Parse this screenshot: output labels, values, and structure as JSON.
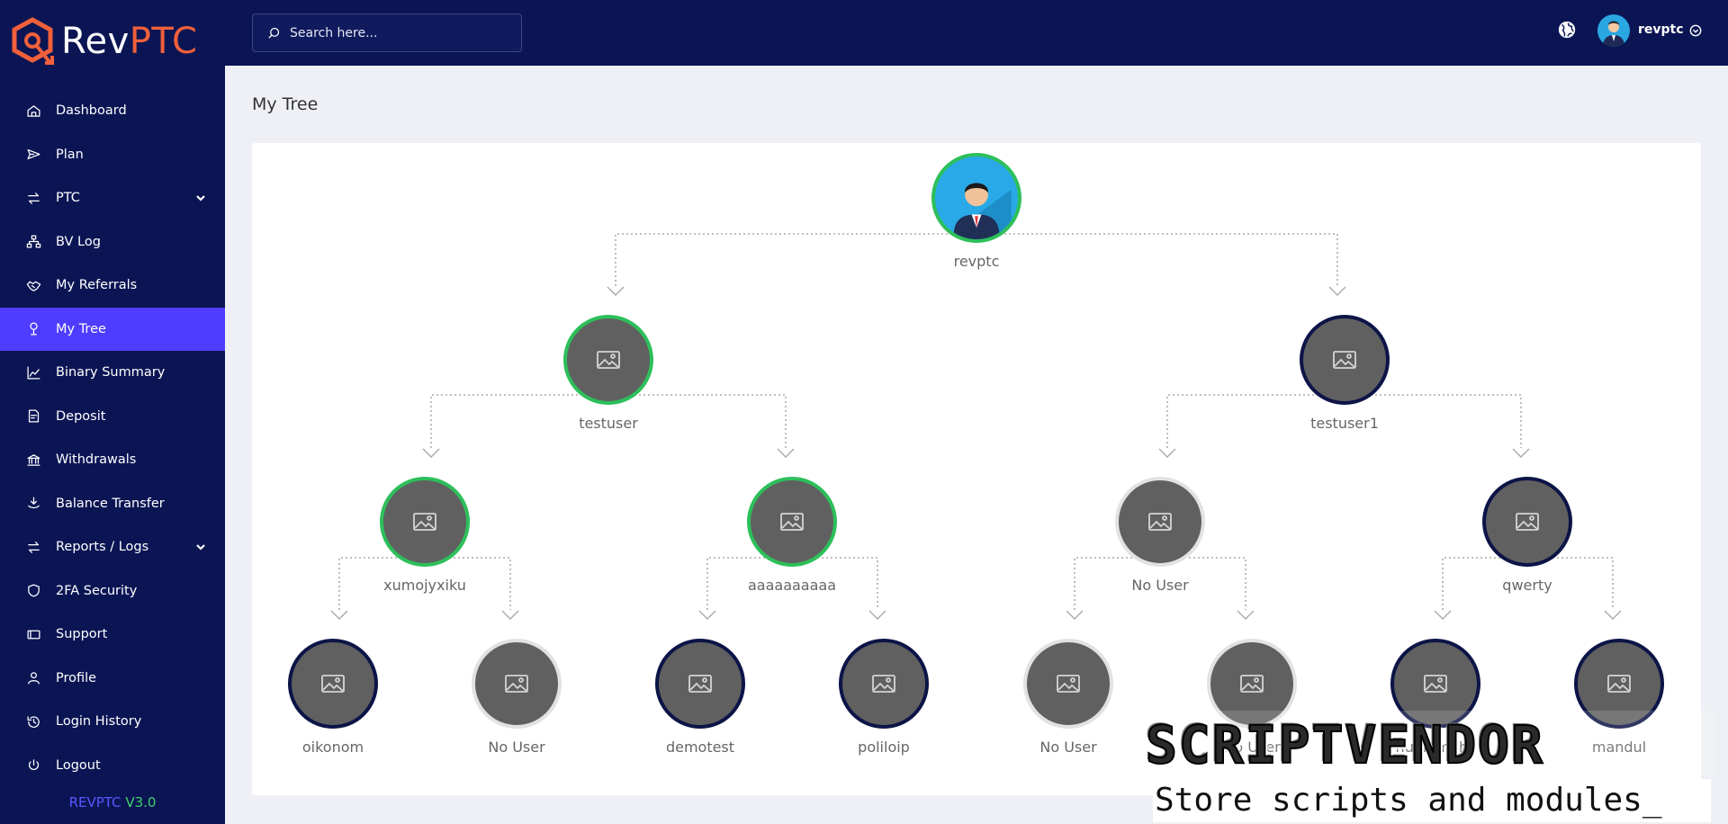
{
  "brand": {
    "name_part1": "Rev",
    "name_part2": "PTC",
    "accent": "#f0603a"
  },
  "sidebar": {
    "items": [
      {
        "label": "Dashboard",
        "icon": "home-icon"
      },
      {
        "label": "Plan",
        "icon": "send-icon"
      },
      {
        "label": "PTC",
        "icon": "swap-icon",
        "has_children": true
      },
      {
        "label": "BV Log",
        "icon": "sitemap-icon"
      },
      {
        "label": "My Referrals",
        "icon": "handshake-icon"
      },
      {
        "label": "My Tree",
        "icon": "tree-icon",
        "active": true
      },
      {
        "label": "Binary Summary",
        "icon": "chart-icon"
      },
      {
        "label": "Deposit",
        "icon": "deposit-icon"
      },
      {
        "label": "Withdrawals",
        "icon": "bank-icon"
      },
      {
        "label": "Balance Transfer",
        "icon": "transfer-icon"
      },
      {
        "label": "Reports / Logs",
        "icon": "swap-icon",
        "has_children": true
      },
      {
        "label": "2FA Security",
        "icon": "shield-icon"
      },
      {
        "label": "Support",
        "icon": "ticket-icon"
      },
      {
        "label": "Profile",
        "icon": "user-icon"
      },
      {
        "label": "Login History",
        "icon": "history-icon"
      },
      {
        "label": "Logout",
        "icon": "logout-icon"
      }
    ],
    "version_name": "REVPTC",
    "version_number": "V3.0"
  },
  "header": {
    "search_placeholder": "Search here...",
    "username": "revptc"
  },
  "page": {
    "title": "My Tree"
  },
  "tree": {
    "root": "revptc",
    "level1": [
      "testuser",
      "testuser1"
    ],
    "level2": [
      "xumojyxiku",
      "aaaaaaaaaa",
      "No User",
      "qwerty"
    ],
    "level3": [
      "oikonom",
      "No User",
      "demotest",
      "poliloip",
      "No User",
      "No User",
      "hublumahs",
      "mandul"
    ]
  },
  "watermark": {
    "title": "SCRIPTVENDOR",
    "subtitle": "Store scripts and modules_"
  }
}
